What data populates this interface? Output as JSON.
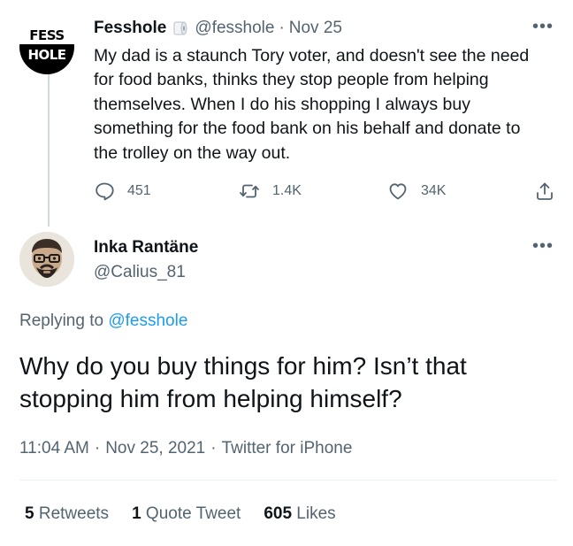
{
  "parent_tweet": {
    "author_name": "Fesshole",
    "avatar_text_top": "FESS",
    "avatar_text_bottom": "HOLE",
    "badge_icon": "toilet-roll-icon",
    "handle": "@fesshole",
    "separator": "·",
    "date": "Nov 25",
    "text": "My dad is a staunch Tory voter, and doesn't see the need for food banks, thinks they stop people from helping themselves. When I do his shopping I always buy something for the food bank on his behalf and donate to the trolley on the way out.",
    "more_icon": "•••",
    "actions": {
      "replies": "451",
      "retweets": "1.4K",
      "likes": "34K"
    }
  },
  "reply_tweet": {
    "author_name": "Inka Rantäne",
    "handle": "@Calius_81",
    "more_icon": "•••",
    "replying_prefix": "Replying to",
    "replying_to": "@fesshole",
    "text": "Why do you buy things for him? Isn’t that stopping him from helping himself?",
    "time": "11:04 AM",
    "separator": "·",
    "date": "Nov 25, 2021",
    "source": "Twitter for iPhone"
  },
  "stats": {
    "retweets_count": "5",
    "retweets_label": "Retweets",
    "quotes_count": "1",
    "quotes_label": "Quote Tweet",
    "likes_count": "605",
    "likes_label": "Likes"
  },
  "colors": {
    "text_primary": "#0f1419",
    "text_secondary": "#536471",
    "link": "#1d9bf0",
    "divider": "#eff3f4",
    "thread_line": "#cfd9de"
  }
}
